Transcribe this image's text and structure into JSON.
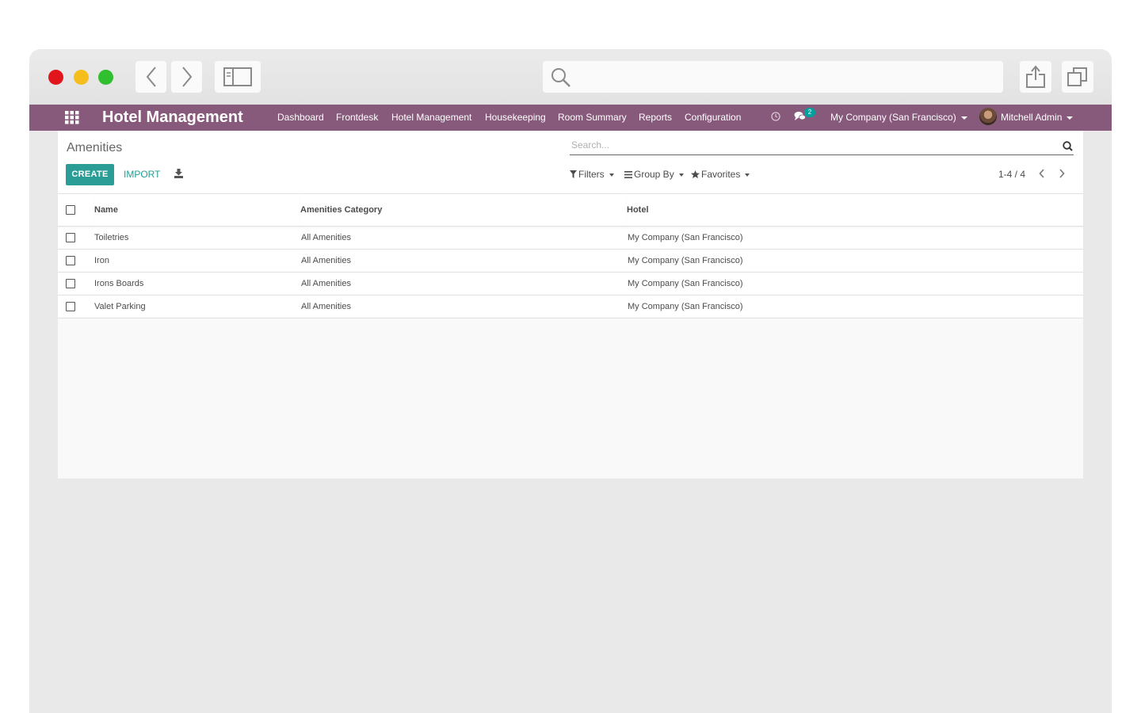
{
  "navbar": {
    "brand": "Hotel Management",
    "menu": [
      "Dashboard",
      "Frontdesk",
      "Hotel Management",
      "Housekeeping",
      "Room Summary",
      "Reports",
      "Configuration"
    ],
    "messages_badge": "2",
    "company": "My Company (San Francisco)",
    "user": "Mitchell Admin"
  },
  "control_panel": {
    "breadcrumb": "Amenities",
    "search_placeholder": "Search...",
    "create_label": "CREATE",
    "import_label": "IMPORT",
    "filters_label": "Filters",
    "groupby_label": "Group By",
    "favorites_label": "Favorites",
    "pager": "1-4 / 4"
  },
  "table": {
    "columns": [
      "Name",
      "Amenities Category",
      "Hotel"
    ],
    "rows": [
      {
        "name": "Toiletries",
        "category": "All Amenities",
        "hotel": "My Company (San Francisco)"
      },
      {
        "name": "Iron",
        "category": "All Amenities",
        "hotel": "My Company (San Francisco)"
      },
      {
        "name": "Irons Boards",
        "category": "All Amenities",
        "hotel": "My Company (San Francisco)"
      },
      {
        "name": "Valet Parking",
        "category": "All Amenities",
        "hotel": "My Company (San Francisco)"
      }
    ]
  },
  "colors": {
    "navbar": "#875a7b",
    "primary_button": "#2a9d96",
    "badge": "#00a09d"
  }
}
